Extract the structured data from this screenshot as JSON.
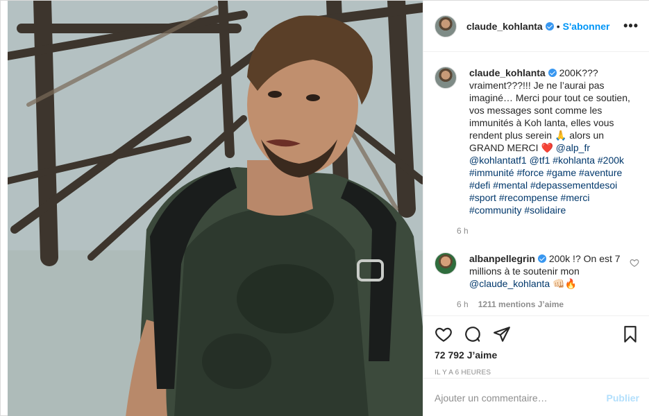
{
  "post": {
    "author": "claude_kohlanta",
    "follow_label": "S'abonner",
    "separator": "•",
    "more_label": "•••",
    "caption": {
      "username": "claude_kohlanta",
      "text_before": "200K??? vraiment???!!! Je ne l’aurai pas imaginé… Merci pour tout ce soutien, vos messages sont comme les immunités à Koh lanta, elles vous rendent plus serein 🙏 alors un GRAND MERCI ❤️ ",
      "tags": [
        "@alp_fr",
        "@kohlantatf1",
        "@tf1",
        "#kohlanta",
        "#200k",
        "#immunité",
        "#force",
        "#game",
        "#aventure",
        "#defi",
        "#mental",
        "#depassementdesoi",
        "#sport",
        "#recompense",
        "#merci",
        "#community",
        "#solidaire"
      ],
      "time": "6 h"
    },
    "comment": {
      "username": "albanpellegrin",
      "text_before": "200k !? On est 7 millions à te soutenir mon ",
      "mention": "@claude_kohlanta",
      "text_after": " 👊🏻🔥",
      "time": "6 h",
      "likes": "1211 mentions J’aime"
    },
    "likes": "72 792 J’aime",
    "timestamp": "IL Y A 6 HEURES",
    "add_comment_placeholder": "Ajouter un commentaire…",
    "publish_label": "Publier"
  },
  "icons": {
    "like": "heart-icon",
    "comment": "comment-icon",
    "share": "paper-plane-icon",
    "save": "bookmark-icon",
    "verified": "verified-badge-icon"
  },
  "colors": {
    "follow": "#0095f6",
    "verified": "#3897f0",
    "tag": "#00376b",
    "muted": "#8e8e8e",
    "publish_disabled": "#b2dffc"
  }
}
